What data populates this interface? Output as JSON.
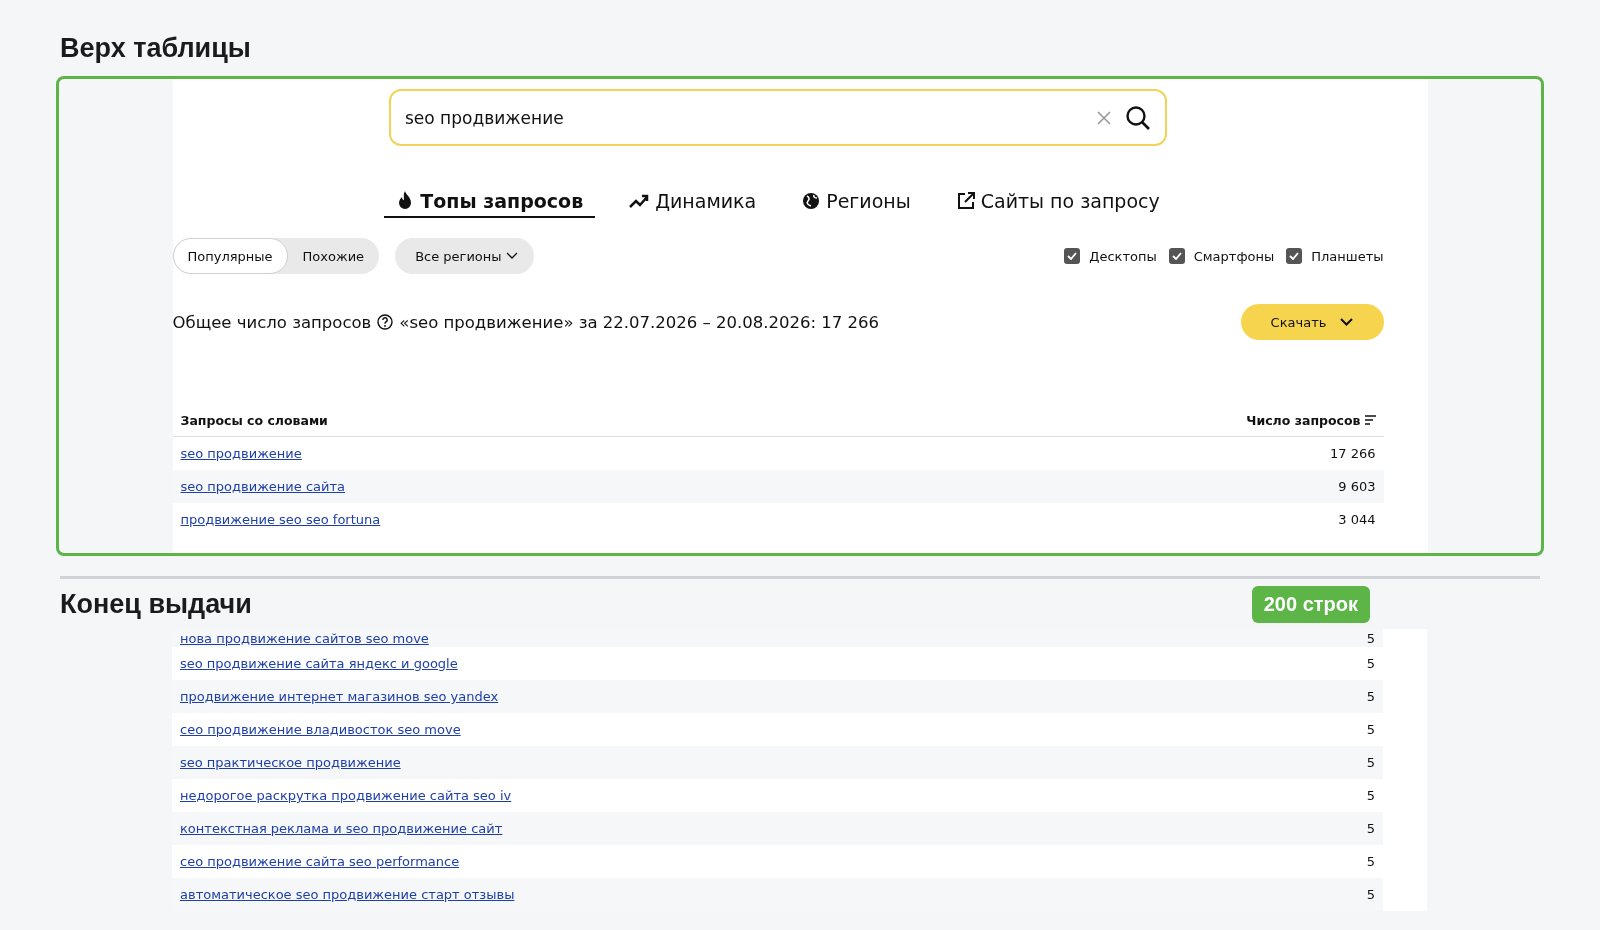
{
  "top_section": {
    "title": "Верх таблицы",
    "search": {
      "value": "seo продвижение"
    },
    "tabs": [
      {
        "label": "Топы запросов",
        "selected": true
      },
      {
        "label": "Динамика",
        "selected": false
      },
      {
        "label": "Регионы",
        "selected": false
      },
      {
        "label": "Сайты по запросу",
        "selected": false
      }
    ],
    "modes": [
      {
        "label": "Популярные",
        "selected": true
      },
      {
        "label": "Похожие",
        "selected": false
      }
    ],
    "region_dropdown": "Все регионы",
    "devices": [
      {
        "label": "Десктопы",
        "checked": true
      },
      {
        "label": "Смартфоны",
        "checked": true
      },
      {
        "label": "Планшеты",
        "checked": true
      }
    ],
    "summary_label": "Общее число запросов",
    "summary_value": "«seo продвижение» за 22.07.2026 – 20.08.2026: 17 266",
    "download_button": "Скачать",
    "table": {
      "columns": [
        "Запросы со словами",
        "Число запросов"
      ],
      "rows": [
        {
          "query": "seo продвижение",
          "count": "17 266"
        },
        {
          "query": "seo продвижение сайта",
          "count": "9 603"
        },
        {
          "query": "продвижение seo seo fortuna",
          "count": "3 044"
        }
      ]
    }
  },
  "bottom_section": {
    "title": "Конец выдачи",
    "badge": "200 строк",
    "rows": [
      {
        "query": "нова продвижение сайтов seo move",
        "count": "5"
      },
      {
        "query": "seo продвижение сайта яндекс и google",
        "count": "5"
      },
      {
        "query": "продвижение интернет магазинов seo yandex",
        "count": "5"
      },
      {
        "query": "сео продвижение владивосток seo move",
        "count": "5"
      },
      {
        "query": "seo практическое продвижение",
        "count": "5"
      },
      {
        "query": "недорогое раскрутка продвижение сайта seo iv",
        "count": "5"
      },
      {
        "query": "контекстная реклама и seo продвижение сайт",
        "count": "5"
      },
      {
        "query": "сео продвижение сайта seo performance",
        "count": "5"
      },
      {
        "query": "автоматическое seo продвижение старт отзывы",
        "count": "5"
      }
    ]
  }
}
